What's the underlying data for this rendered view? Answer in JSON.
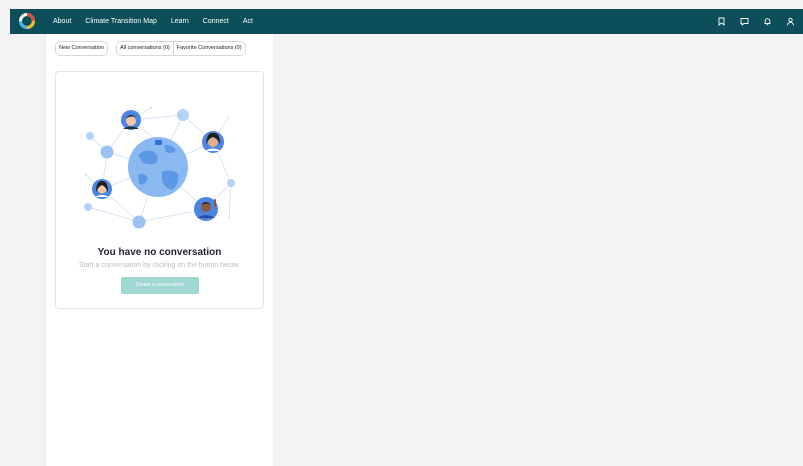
{
  "topbar": {
    "background": "#0c4f5a",
    "logo_icon": "ring-logo-icon",
    "nav": [
      "About",
      "Climate Transition Map",
      "Learn",
      "Connect",
      "Act"
    ],
    "icons": [
      "bookmark-icon",
      "chat-icon",
      "bell-icon",
      "user-icon"
    ]
  },
  "conversations": {
    "new_label": "New Conversation",
    "all_label": "All conversations (0)",
    "favorite_label": "Favorite Conversations (0)"
  },
  "empty_state": {
    "illustration": "connected-globe-illustration",
    "title": "You have no conversation",
    "subtitle": "Start a conversation by clicking on the button below.",
    "button_label": "Create a conversation",
    "button_color": "#9fd8d2"
  }
}
